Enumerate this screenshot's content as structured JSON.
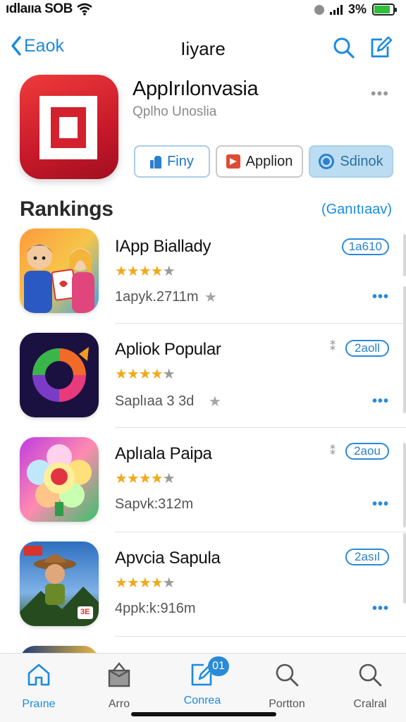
{
  "status_bar": {
    "carrier": "ıdlaııa SOB",
    "battery_text": "3%",
    "battery_level": 0.85
  },
  "nav": {
    "back_label": "Eaok",
    "title": "Iiyare"
  },
  "app": {
    "name": "AppIrılonvasia",
    "subtitle": "Qplho Unoslia",
    "more": "•••",
    "actions": [
      {
        "label": "Finy",
        "icon": "thumbs-up-icon"
      },
      {
        "label": "Applion",
        "icon": "play-icon"
      },
      {
        "label": "Sdinok",
        "icon": "target-icon"
      }
    ]
  },
  "rankings": {
    "title": "Rankings",
    "link": "(Ganıtıaav)",
    "items": [
      {
        "name": "IApp Biallady",
        "stars": "★★★★",
        "dim_star": "★",
        "meta": "1apyk.2711m",
        "badge": "1a610",
        "more": "•••",
        "star": "★"
      },
      {
        "name": "Apliok Popular",
        "stars": "★★★★",
        "dim_star": "★",
        "meta": "Saplıaa 3 3d",
        "badge": "2aoll",
        "more": "•••",
        "star": "★",
        "share": "⁑"
      },
      {
        "name": "Aplıala Paipa",
        "stars": "★★★★",
        "dim_star": "★",
        "meta": "Sapvk:312m",
        "badge": "2aou",
        "more": "•••",
        "share": "⁑"
      },
      {
        "name": "Apvcia Sapula",
        "stars": "★★★★",
        "dim_star": "★",
        "meta": "4ppk:k:916m",
        "badge": "2asıl",
        "more": "•••",
        "icon_sign": "3E"
      }
    ]
  },
  "tabs": [
    {
      "label": "Praıne",
      "icon": "home-icon",
      "active": true
    },
    {
      "label": "Arro",
      "icon": "gift-icon",
      "active": false
    },
    {
      "label": "Conrea",
      "icon": "edit-icon",
      "active": true,
      "badge": "01"
    },
    {
      "label": "Portton",
      "icon": "search-icon",
      "active": false
    },
    {
      "label": "Cralral",
      "icon": "search-icon",
      "active": false
    }
  ]
}
